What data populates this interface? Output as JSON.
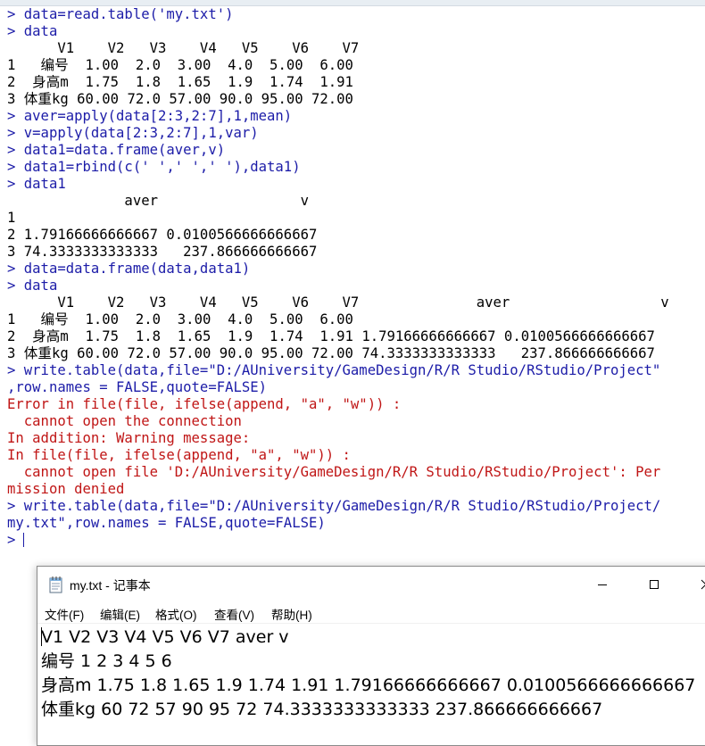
{
  "console": {
    "lines": [
      {
        "text": "> data=read.table('my.txt')",
        "kind": "cmd"
      },
      {
        "text": "> data",
        "kind": "cmd"
      },
      {
        "text": "      V1    V2   V3    V4   V5    V6    V7",
        "kind": "out"
      },
      {
        "text": "1   编号  1.00  2.0  3.00  4.0  5.00  6.00",
        "kind": "out"
      },
      {
        "text": "2  身高m  1.75  1.8  1.65  1.9  1.74  1.91",
        "kind": "out"
      },
      {
        "text": "3 体重kg 60.00 72.0 57.00 90.0 95.00 72.00",
        "kind": "out"
      },
      {
        "text": "> aver=apply(data[2:3,2:7],1,mean)",
        "kind": "cmd"
      },
      {
        "text": "> v=apply(data[2:3,2:7],1,var)",
        "kind": "cmd"
      },
      {
        "text": "> data1=data.frame(aver,v)",
        "kind": "cmd"
      },
      {
        "text": "> data1=rbind(c(' ',' ',' '),data1)",
        "kind": "cmd"
      },
      {
        "text": "> data1",
        "kind": "cmd"
      },
      {
        "text": "              aver                 v",
        "kind": "out"
      },
      {
        "text": "1",
        "kind": "out"
      },
      {
        "text": "2 1.79166666666667 0.0100566666666667",
        "kind": "out"
      },
      {
        "text": "3 74.3333333333333   237.866666666667",
        "kind": "out"
      },
      {
        "text": "> data=data.frame(data,data1)",
        "kind": "cmd"
      },
      {
        "text": "> data",
        "kind": "cmd"
      },
      {
        "text": "      V1    V2   V3    V4   V5    V6    V7              aver                  v",
        "kind": "out"
      },
      {
        "text": "1   编号  1.00  2.0  3.00  4.0  5.00  6.00",
        "kind": "out"
      },
      {
        "text": "2  身高m  1.75  1.8  1.65  1.9  1.74  1.91 1.79166666666667 0.0100566666666667",
        "kind": "out"
      },
      {
        "text": "3 体重kg 60.00 72.0 57.00 90.0 95.00 72.00 74.3333333333333   237.866666666667",
        "kind": "out"
      },
      {
        "text": "> write.table(data,file=\"D:/AUniversity/GameDesign/R/R Studio/RStudio/Project\"",
        "kind": "cmd"
      },
      {
        "text": ",row.names = FALSE,quote=FALSE)",
        "kind": "cmd"
      },
      {
        "text": "Error in file(file, ifelse(append, \"a\", \"w\")) :",
        "kind": "err"
      },
      {
        "text": "  cannot open the connection",
        "kind": "err"
      },
      {
        "text": "In addition: Warning message:",
        "kind": "err"
      },
      {
        "text": "In file(file, ifelse(append, \"a\", \"w\")) :",
        "kind": "err"
      },
      {
        "text": "  cannot open file 'D:/AUniversity/GameDesign/R/R Studio/RStudio/Project': Per",
        "kind": "err"
      },
      {
        "text": "mission denied",
        "kind": "err"
      },
      {
        "text": "> write.table(data,file=\"D:/AUniversity/GameDesign/R/R Studio/RStudio/Project/",
        "kind": "cmd"
      },
      {
        "text": "my.txt\",row.names = FALSE,quote=FALSE)",
        "kind": "cmd"
      },
      {
        "text": ">",
        "kind": "prompt"
      }
    ]
  },
  "notepad": {
    "title": "my.txt - 记事本",
    "icon": "notepad-icon",
    "controls": {
      "minimize": "minimize-icon",
      "maximize": "maximize-icon",
      "close": "close-icon"
    },
    "menu": [
      "文件(F)",
      "编辑(E)",
      "格式(O)",
      "查看(V)",
      "帮助(H)"
    ],
    "lines": [
      "V1 V2 V3 V4 V5 V6 V7 aver v",
      "编号 1 2 3 4 5 6",
      "身高m 1.75 1.8 1.65 1.9 1.74 1.91 1.79166666666667 0.0100566666666667",
      "体重kg 60 72 57 90 95 72 74.3333333333333 237.866666666667"
    ]
  },
  "colors": {
    "command": "#1c1ca8",
    "output": "#000000",
    "error": "#c01616"
  }
}
